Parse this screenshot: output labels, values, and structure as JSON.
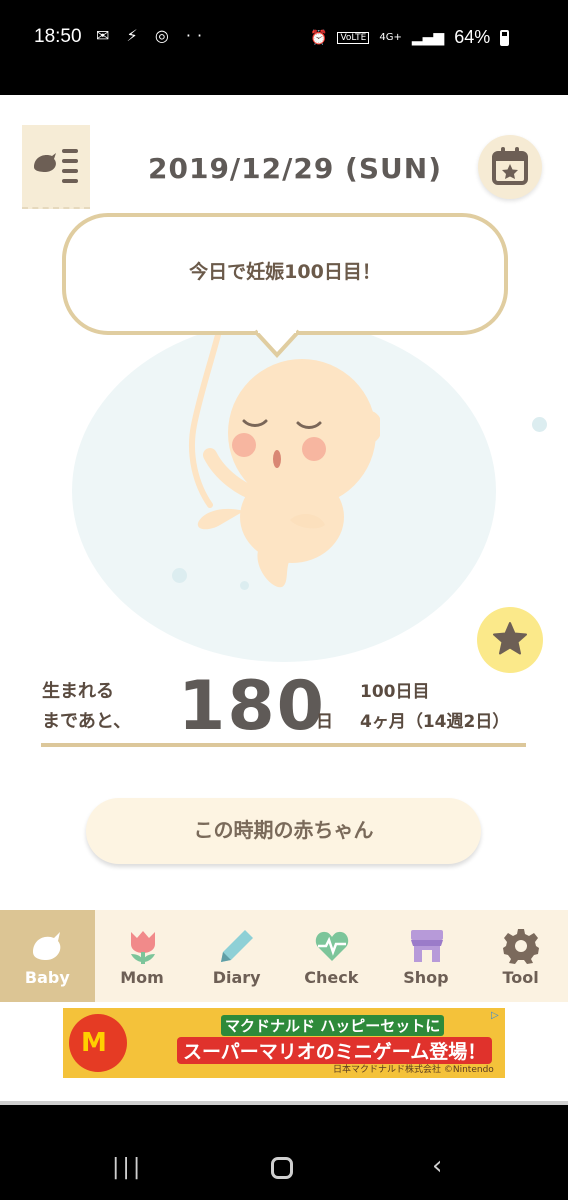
{
  "status_bar": {
    "time": "18:50",
    "left_icons": "✉ ⚡ ◎ ··",
    "right_icons": [
      "alarm-icon",
      "volte-icon",
      "4g-icon",
      "signal-icon"
    ],
    "battery": "64%"
  },
  "header": {
    "date": "2019/12/29 (SUN)"
  },
  "bubble": {
    "message": "今日で妊娠100日目！"
  },
  "countdown": {
    "label_line1": "生まれる",
    "label_line2": "まであと、",
    "days_remaining": "180",
    "unit": "日",
    "day_count": "100日目",
    "month_week": "4ヶ月（14週2日）"
  },
  "period_button": "この時期の赤ちゃん",
  "nav": {
    "items": [
      {
        "label": "Baby",
        "icon": "bird-icon",
        "active": true
      },
      {
        "label": "Mom",
        "icon": "tulip-icon",
        "active": false
      },
      {
        "label": "Diary",
        "icon": "pencil-icon",
        "active": false
      },
      {
        "label": "Check",
        "icon": "heart-pulse-icon",
        "active": false
      },
      {
        "label": "Shop",
        "icon": "shop-icon",
        "active": false
      },
      {
        "label": "Tool",
        "icon": "gear-icon",
        "active": false
      }
    ]
  },
  "ad": {
    "logo": "M",
    "line1": "マクドナルド ハッピーセットに",
    "line2": "スーパーマリオのミニゲーム登場！",
    "footer": "日本マクドナルド株式会社 ©Nintendo",
    "badge": "▷"
  },
  "colors": {
    "accent": "#dcc594",
    "nav_bg": "#fbf2e1",
    "star_bg": "#fbe98a",
    "text_main": "#5f5a57"
  }
}
